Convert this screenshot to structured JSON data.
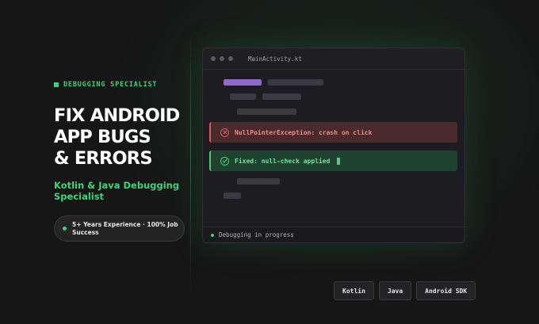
{
  "hero": {
    "eyebrow": "DEBUGGING SPECIALIST",
    "title_lines": [
      "FIX ANDROID",
      "APP BUGS",
      "& ERRORS"
    ],
    "subtitle": "Kotlin & Java Debugging Specialist",
    "badge": "5+ Years Experience · 100% Job Success"
  },
  "editor": {
    "filename": "MainActivity.kt",
    "error_text": "NullPointerException: crash on click",
    "fixed_text": "Fixed: null-check applied",
    "status": "Debugging in progress"
  },
  "tags": [
    "Kotlin",
    "Java",
    "Android SDK"
  ],
  "colors": {
    "accent": "#3fd17a",
    "error": "#e0595f",
    "purple": "#9167c7",
    "background": "#161616"
  }
}
